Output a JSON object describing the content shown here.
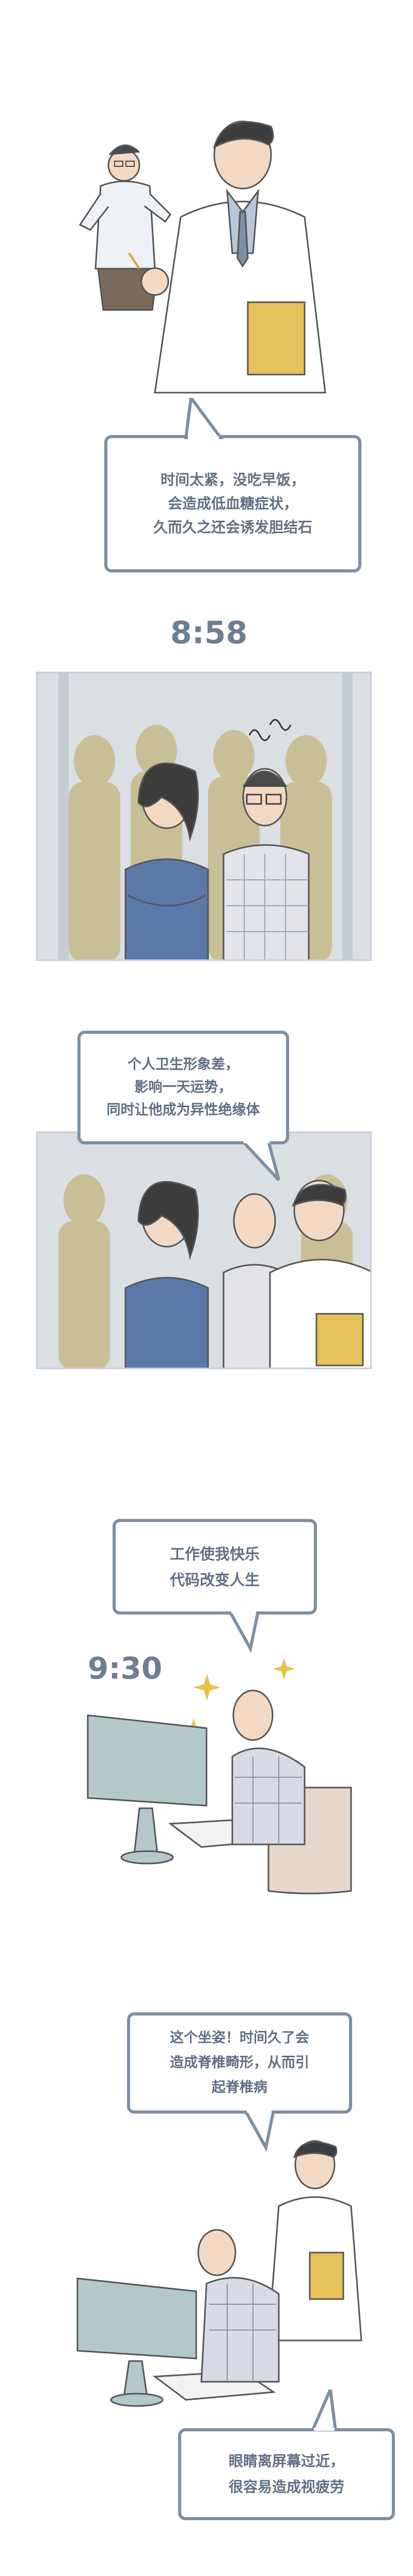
{
  "bubbles": {
    "b1": {
      "lines": [
        "时间太紧，没吃早饭，",
        "会造成低血糖症状，",
        "久而久之还会诱发胆结石"
      ]
    },
    "b2": {
      "lines": [
        "个人卫生形象差，",
        "影响一天运势，",
        "同时让他成为异性绝缘体"
      ]
    },
    "b3": {
      "lines": [
        "工作使我快乐",
        "代码改变人生"
      ]
    },
    "b4": {
      "lines": [
        "这个坐姿！时间久了会",
        "造成脊椎畸形，从而引",
        "起脊椎病"
      ]
    },
    "b5": {
      "lines": [
        "眼睛离屏幕过近，",
        "很容易造成视疲劳"
      ]
    }
  },
  "times": {
    "t1": "8:58",
    "t2": "9:30"
  },
  "colors": {
    "border": "#7f8ea2",
    "text": "#5f6f85",
    "coat": "#ffffff",
    "tie": "#b9c7da",
    "folder": "#e7c25a",
    "star": "#e6c24a"
  }
}
